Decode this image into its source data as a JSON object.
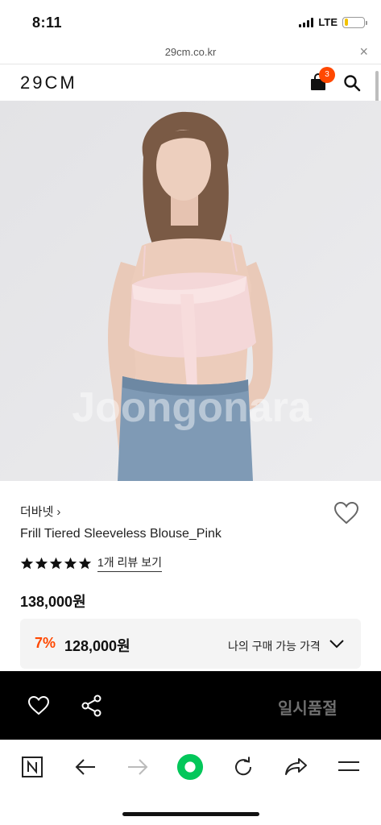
{
  "status_bar": {
    "time": "8:11",
    "network": "LTE"
  },
  "url_bar": {
    "url": "29cm.co.kr",
    "close_label": "×"
  },
  "header": {
    "logo": "29CM",
    "cart_count": "3"
  },
  "product": {
    "brand": "더바넷",
    "brand_chevron": "›",
    "name": "Frill Tiered Sleeveless Blouse_Pink",
    "rating_stars": 5,
    "review_link": "1개 리뷰 보기",
    "price": "138,000원",
    "my_price": {
      "discount": "7%",
      "price": "128,000원",
      "label": "나의 구매 가능 가격"
    },
    "image_watermark": "Joongonara"
  },
  "action_bar": {
    "sold_out_label": "일시품절"
  },
  "colors": {
    "accent": "#ff4800",
    "action_bar_bg": "#000000",
    "sold_out_text": "#6f6f6f",
    "my_price_bg": "#f4f4f4",
    "naver_green": "#03c75a"
  }
}
